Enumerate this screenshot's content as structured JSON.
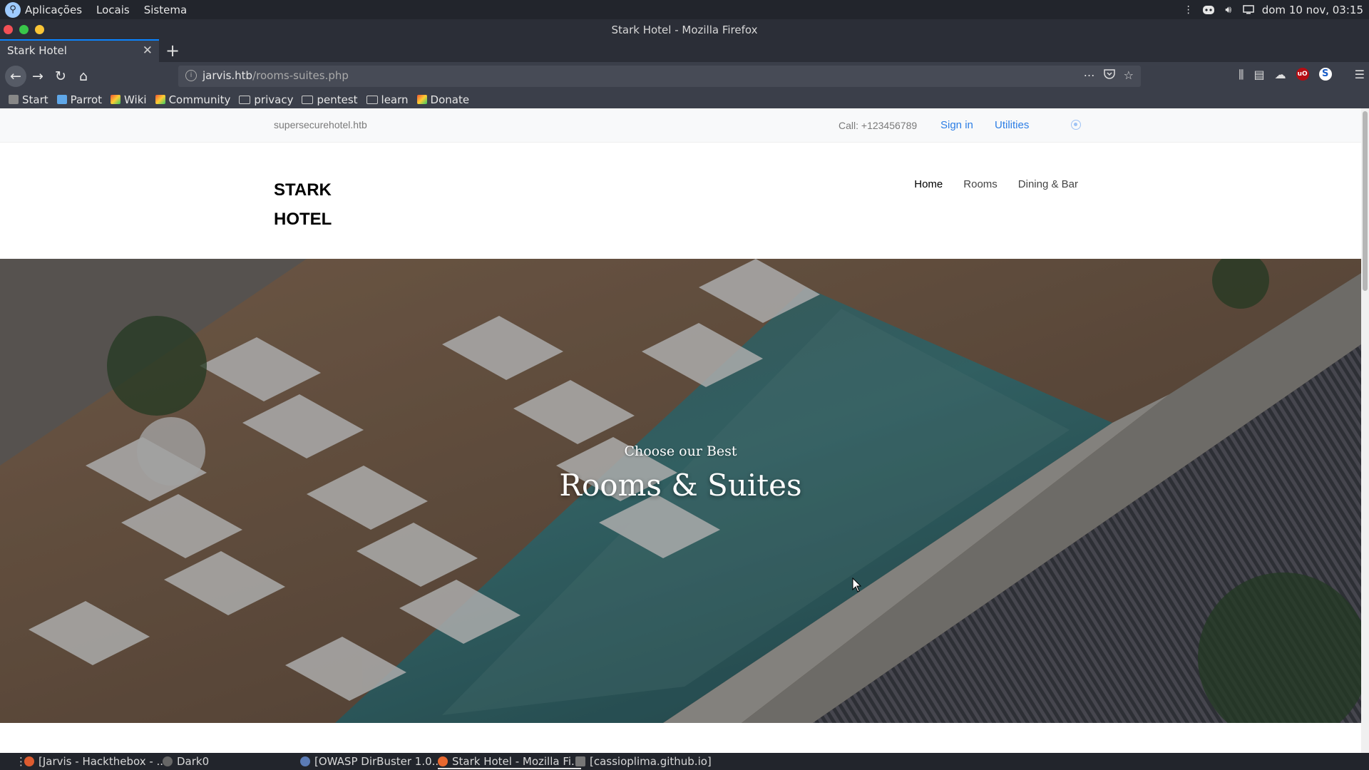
{
  "desktop": {
    "menu": [
      "Aplicações",
      "Locais",
      "Sistema"
    ],
    "clock": "dom 10 nov, 03:15"
  },
  "window": {
    "title": "Stark Hotel - Mozilla Firefox"
  },
  "browser": {
    "tab_label": "Stark Hotel",
    "url_host": "jarvis.htb",
    "url_path": "/rooms-suites.php",
    "bookmarks": {
      "start": "Start",
      "parrot": "Parrot",
      "wiki": "Wiki",
      "community": "Community",
      "privacy": "privacy",
      "pentest": "pentest",
      "learn": "learn",
      "donate": "Donate"
    }
  },
  "site": {
    "domain": "supersecurehotel.htb",
    "call": "Call: +123456789",
    "sign_in": "Sign in",
    "utilities": "Utilities",
    "logo_line1": "STARK",
    "logo_line2": "HOTEL",
    "nav": {
      "home": "Home",
      "rooms": "Rooms",
      "dining": "Dining & Bar"
    },
    "hero_subtitle": "Choose our Best",
    "hero_title": "Rooms & Suites"
  },
  "taskbar": {
    "t1": "[Jarvis - Hackthebox - ...",
    "t2": "Dark0",
    "t3": "[OWASP DirBuster 1.0...",
    "t4": "Stark Hotel - Mozilla Fi...",
    "t5": "[cassioplima.github.io]"
  },
  "colors": {
    "accent": "#0a84ff",
    "link": "#2c7ee5"
  }
}
